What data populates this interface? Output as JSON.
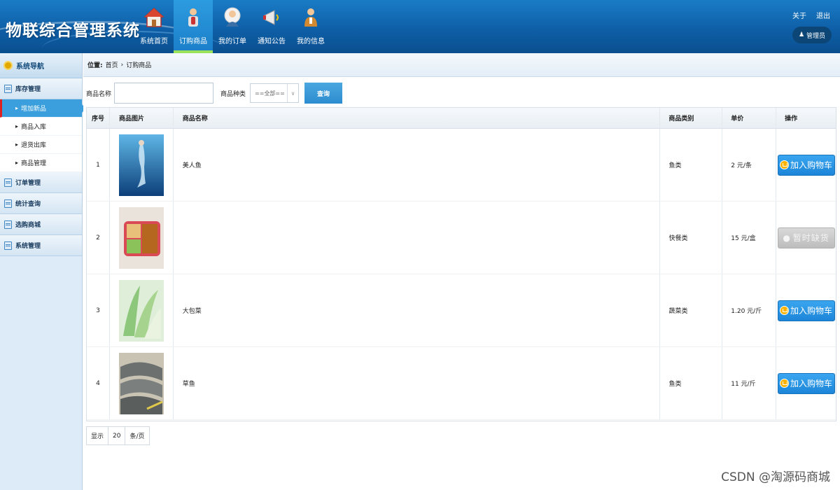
{
  "app": {
    "title": "物联综合管理系统"
  },
  "nav": [
    {
      "label": "系统首页",
      "icon": "home-icon"
    },
    {
      "label": "订购商品",
      "icon": "person-bottle-icon",
      "active": true
    },
    {
      "label": "我的订单",
      "icon": "user-avatar-icon"
    },
    {
      "label": "通知公告",
      "icon": "megaphone-icon"
    },
    {
      "label": "我的信息",
      "icon": "person-icon"
    }
  ],
  "top_links": {
    "about": "关于",
    "logout": "退出"
  },
  "user": {
    "name": "管理员"
  },
  "sidebar": {
    "header": "系统导航",
    "groups": [
      {
        "label": "库存管理",
        "items": [
          {
            "label": "增加新品",
            "active": true
          },
          {
            "label": "商品入库"
          },
          {
            "label": "退货出库"
          },
          {
            "label": "商品管理"
          }
        ]
      },
      {
        "label": "订单管理"
      },
      {
        "label": "统计查询"
      },
      {
        "label": "选购商城"
      },
      {
        "label": "系统管理"
      }
    ]
  },
  "breadcrumb": {
    "prefix": "位置:",
    "home": "首页",
    "separator": "›",
    "current": "订购商品"
  },
  "search": {
    "name_label": "商品名称",
    "name_value": "",
    "type_label": "商品种类",
    "type_selected": "==全部==",
    "query_button": "查询"
  },
  "table": {
    "headers": [
      "序号",
      "商品图片",
      "商品名称",
      "商品类别",
      "单价",
      "操作"
    ],
    "rows": [
      {
        "no": "1",
        "name": "美人鱼",
        "category": "鱼类",
        "price": "2 元/条",
        "action": "加入购物车",
        "available": true,
        "thumb_color": "#1c5a9a"
      },
      {
        "no": "2",
        "name": "",
        "category": "快餐类",
        "price": "15 元/盒",
        "action": "暂时缺货",
        "available": false,
        "thumb_color": "#b8736c"
      },
      {
        "no": "3",
        "name": "大包菜",
        "category": "蔬菜类",
        "price": "1.20 元/斤",
        "action": "加入购物车",
        "available": true,
        "thumb_color": "#6fa368"
      },
      {
        "no": "4",
        "name": "草鱼",
        "category": "鱼类",
        "price": "11 元/斤",
        "action": "加入购物车",
        "available": true,
        "thumb_color": "#5f6566"
      }
    ]
  },
  "pager": {
    "show": "显示",
    "page_size": "20",
    "unit": "条/页"
  },
  "watermark": "CSDN @淘源码商城",
  "colors": {
    "header": "#0e5fa7",
    "accent": "#1c85d8",
    "active_nav_border": "#9be25a"
  }
}
